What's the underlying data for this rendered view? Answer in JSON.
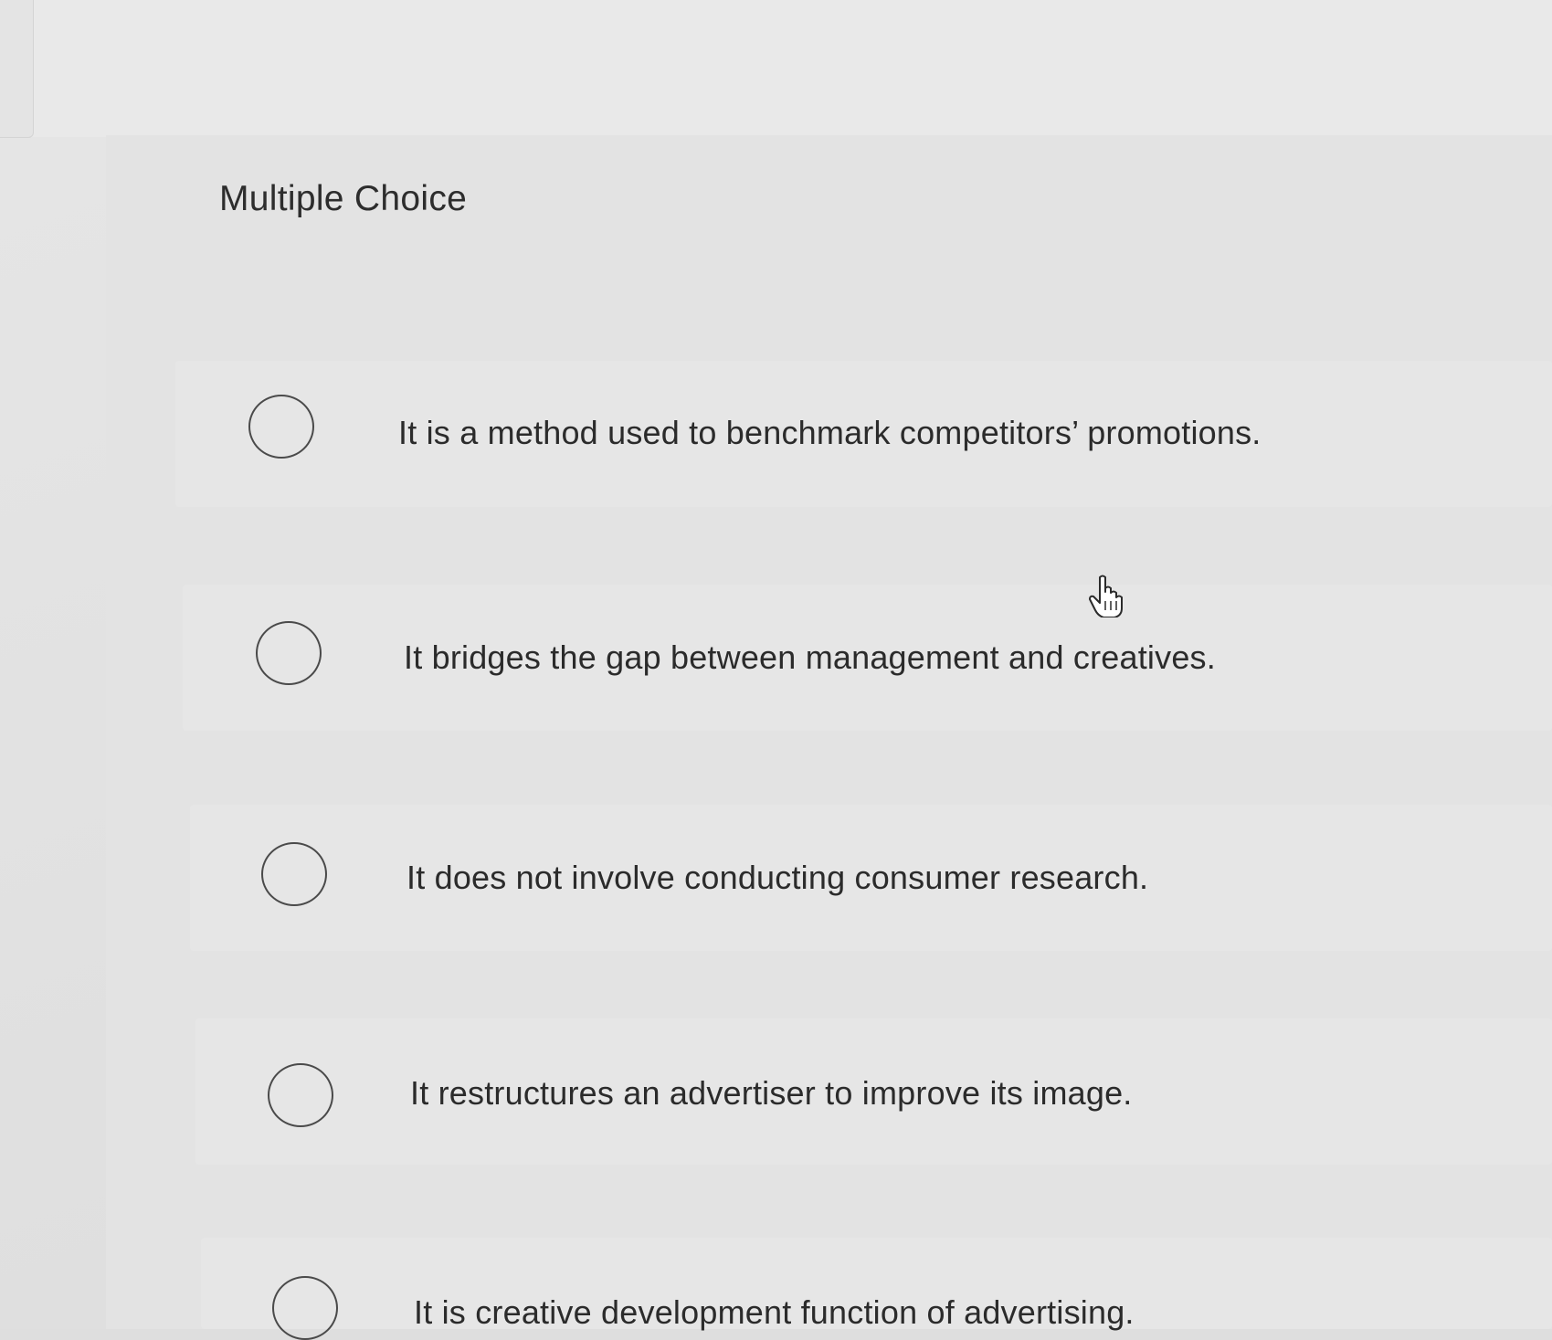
{
  "question": {
    "type_label": "Multiple Choice"
  },
  "options": [
    {
      "label": "It is a method used to benchmark competitors’ promotions."
    },
    {
      "label": "It bridges the gap between management and creatives."
    },
    {
      "label": "It does not involve conducting consumer research."
    },
    {
      "label": "It restructures an advertiser to improve its image."
    },
    {
      "label": "It is creative development function of advertising."
    }
  ],
  "icons": {
    "radio": "radio-unchecked-icon",
    "cursor": "hand-pointer-cursor-icon"
  }
}
